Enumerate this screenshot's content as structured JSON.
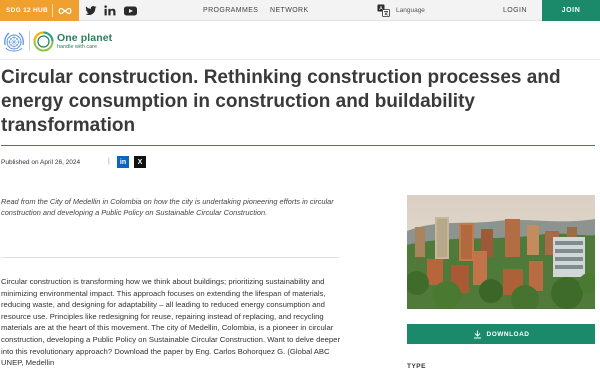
{
  "topbar": {
    "sdg_label": "SDG 12 HUB",
    "nav": [
      "PROGRAMMES",
      "NETWORK"
    ],
    "language_label": "Language",
    "login_label": "LOGIN",
    "join_label": "JOIN",
    "icons": [
      "infinity-icon",
      "twitter-icon",
      "linkedin-icon",
      "youtube-icon",
      "translate-icon"
    ]
  },
  "logo": {
    "title": "One planet",
    "subtitle": "handle with care"
  },
  "article": {
    "title": "Circular construction. Rethinking construction processes and energy consumption in construction and buildability transformation",
    "published": "Published on April 26, 2024",
    "separator": "|",
    "intro": "Read from the City of Medellin in Colombia on how the city is undertaking pioneering efforts in circular construction and developing a Public Policy on Sustainable Circular Construction.",
    "body": "Circular construction is transforming how we think about buildings; prioritizing sustainability and minimizing environmental impact. This approach focuses on extending the lifespan of materials, reducing waste, and designing for adaptability – all leading to reduced energy consumption and resource use. Principles like redesigning for reuse, repairing instead of replacing, and recycling materials are at the heart of this movement. The city of Medellin, Colombia, is a pioneer in circular construction, developing a Public Policy on Sustainable Circular Construction. Want to delve deeper into this revolutionary approach? Download the paper by Eng. Carlos Bohorquez G. (Global ABC UNEP, Medellin"
  },
  "share": {
    "linkedin_label": "in",
    "x_label": "X"
  },
  "sidebar": {
    "download_label": "DOWNLOAD",
    "type_label": "TYPE"
  },
  "colors": {
    "sdg_orange": "#f0a02f",
    "brand_green": "#1b8a6b",
    "rule_blue": "#3a73b5"
  }
}
